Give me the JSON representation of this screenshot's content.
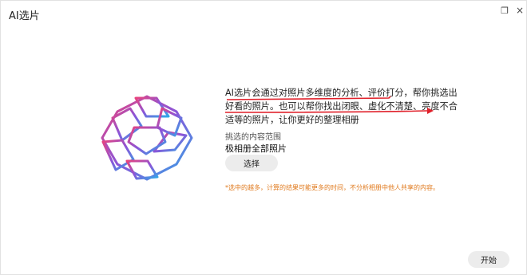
{
  "window": {
    "title": "AI选片",
    "restore_icon": "restore-window-icon",
    "close_icon": "close-icon",
    "close_glyph": "×",
    "restore_glyph": "❐"
  },
  "description": {
    "line1": "AI选片会通过对照片多维度的分析、评价打分，帮你挑选出",
    "line2": "好看的照片。也可以帮你找出闭眼、虚化不清楚、亮度不合",
    "line3": "适等的照片，让你更好的整理相册"
  },
  "scope": {
    "label": "挑选的内容范围",
    "value": "极相册全部照片"
  },
  "buttons": {
    "select": "选择",
    "start": "开始"
  },
  "note": "*选中的越多，计算的结果可能更多的时间，不分析相册中他人共享的内容。",
  "colors": {
    "accent_orange": "#e07a1e",
    "annotation_red": "#e0202a",
    "logo_gradient": [
      "#e8437e",
      "#8b55d8",
      "#2fa9e8"
    ]
  }
}
